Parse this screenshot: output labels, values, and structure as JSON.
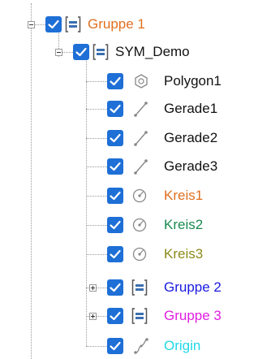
{
  "tree": {
    "items": [
      {
        "label": "Gruppe 1",
        "color": "#e07020",
        "icon": "group-icon"
      },
      {
        "label": "SYM_Demo",
        "color": "#111111",
        "icon": "group-icon"
      },
      {
        "label": "Polygon1",
        "color": "#111111",
        "icon": "polygon-icon"
      },
      {
        "label": "Gerade1",
        "color": "#111111",
        "icon": "line-icon"
      },
      {
        "label": "Gerade2",
        "color": "#111111",
        "icon": "line-icon"
      },
      {
        "label": "Gerade3",
        "color": "#111111",
        "icon": "line-icon"
      },
      {
        "label": "Kreis1",
        "color": "#e07020",
        "icon": "circle-icon"
      },
      {
        "label": "Kreis2",
        "color": "#1a8a50",
        "icon": "circle-icon"
      },
      {
        "label": "Kreis3",
        "color": "#8a8a1a",
        "icon": "circle-icon"
      },
      {
        "label": "Gruppe 2",
        "color": "#1a1ae0",
        "icon": "group-icon"
      },
      {
        "label": "Gruppe 3",
        "color": "#e020e0",
        "icon": "group-icon"
      },
      {
        "label": "Origin",
        "color": "#20d8e8",
        "icon": "origin-icon"
      }
    ]
  }
}
